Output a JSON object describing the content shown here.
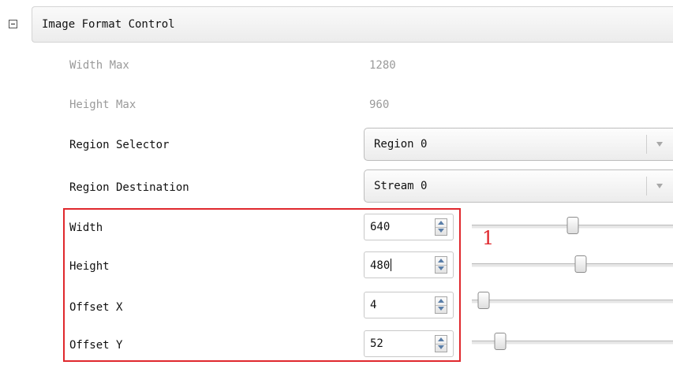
{
  "category": {
    "title": "Image Format Control"
  },
  "readonly_rows": [
    {
      "label": "Width Max",
      "value": "1280"
    },
    {
      "label": "Height Max",
      "value": "960"
    }
  ],
  "selectors": [
    {
      "label": "Region Selector",
      "value": "Region 0"
    },
    {
      "label": "Region Destination",
      "value": "Stream 0"
    }
  ],
  "numeric_rows": [
    {
      "label": "Width",
      "value": "640",
      "slider_fraction": 0.5
    },
    {
      "label": "Height",
      "value": "480",
      "slider_fraction": 0.54
    },
    {
      "label": "Offset X",
      "value": "4",
      "slider_fraction": 0.06
    },
    {
      "label": "Offset Y",
      "value": "52",
      "slider_fraction": 0.14
    }
  ],
  "annotation": {
    "label": "1",
    "color": "#e0282d"
  }
}
